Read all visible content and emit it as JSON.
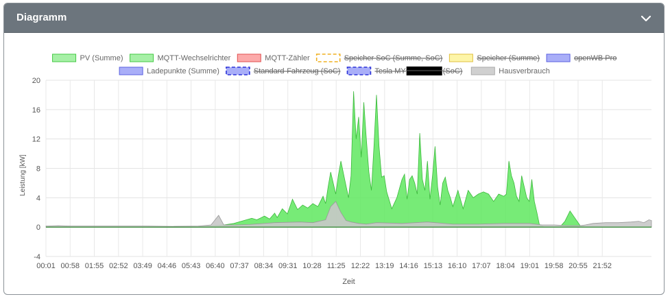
{
  "panel": {
    "title": "Diagramm",
    "collapse_icon": "chevron-down-icon"
  },
  "chart_data": {
    "type": "area",
    "xlabel": "Zeit",
    "ylabel": "Leistung [kW]",
    "ylim": [
      -4,
      20
    ],
    "yticks": [
      -4,
      0,
      4,
      8,
      12,
      16,
      20
    ],
    "xlim": [
      0.0167,
      23.8
    ],
    "xticks": [
      "00:01",
      "00:58",
      "01:55",
      "02:52",
      "03:49",
      "04:46",
      "05:43",
      "06:40",
      "07:37",
      "08:34",
      "09:31",
      "10:28",
      "11:25",
      "12:22",
      "13:19",
      "14:16",
      "15:13",
      "16:10",
      "17:07",
      "18:04",
      "19:01",
      "19:58",
      "20:55",
      "21:52"
    ],
    "grid": true,
    "legend_position": "top",
    "legend": [
      {
        "name": "PV (Summe)",
        "fill": "#a6f0a6",
        "stroke": "#44c944",
        "dashed": false,
        "hidden": false
      },
      {
        "name": "MQTT-Wechselrichter",
        "fill": "#a6f0a6",
        "stroke": "#44c944",
        "dashed": false,
        "hidden": false
      },
      {
        "name": "MQTT-Zähler",
        "fill": "#fcaaaa",
        "stroke": "#e05050",
        "dashed": false,
        "hidden": false
      },
      {
        "name": "Speicher SoC (Summe, SoC)",
        "fill": "#ffffff",
        "stroke": "#f0b020",
        "dashed": true,
        "hidden": true
      },
      {
        "name": "Speicher (Summe)",
        "fill": "#fdf5a8",
        "stroke": "#e0c040",
        "dashed": false,
        "hidden": true
      },
      {
        "name": "openWB Pro",
        "fill": "#a9aef8",
        "stroke": "#5a60e0",
        "dashed": false,
        "hidden": true
      },
      {
        "name": "Ladepunkte (Summe)",
        "fill": "#a9aef8",
        "stroke": "#5a60e0",
        "dashed": false,
        "hidden": false
      },
      {
        "name": "Standard-Fahrzeug (SoC)",
        "fill": "#a9aef8",
        "stroke": "#2b32d8",
        "dashed": true,
        "hidden": true
      },
      {
        "name": "Tesla MY",
        "suffix": "(SoC)",
        "fill": "#a9aef8",
        "stroke": "#2b32d8",
        "dashed": true,
        "hidden": true,
        "redacted": true
      },
      {
        "name": "Hausverbrauch",
        "fill": "#d0d0d0",
        "stroke": "#aaaaaa",
        "dashed": false,
        "hidden": false
      }
    ],
    "series": [
      {
        "name": "PV (Summe)",
        "color": "#5fe85f",
        "stroke": "#3bb83b",
        "x": [
          0.02,
          6.0,
          6.6,
          7.0,
          7.4,
          7.8,
          8.1,
          8.3,
          8.6,
          8.8,
          9.0,
          9.1,
          9.3,
          9.5,
          9.7,
          9.9,
          10.1,
          10.3,
          10.5,
          10.7,
          10.9,
          11.0,
          11.1,
          11.2,
          11.3,
          11.4,
          11.5,
          11.6,
          11.75,
          11.9,
          12.0,
          12.1,
          12.2,
          12.3,
          12.4,
          12.5,
          12.6,
          12.7,
          12.8,
          12.9,
          13.0,
          13.1,
          13.2,
          13.3,
          13.4,
          13.6,
          13.8,
          14.0,
          14.1,
          14.2,
          14.3,
          14.4,
          14.5,
          14.6,
          14.7,
          14.8,
          14.9,
          15.0,
          15.1,
          15.2,
          15.3,
          15.4,
          15.5,
          15.6,
          15.7,
          15.8,
          15.9,
          16.0,
          16.2,
          16.4,
          16.6,
          16.8,
          17.0,
          17.2,
          17.4,
          17.6,
          17.8,
          18.0,
          18.1,
          18.2,
          18.3,
          18.4,
          18.5,
          18.6,
          18.7,
          18.8,
          18.9,
          19.0,
          19.1,
          19.2,
          19.3,
          19.4,
          19.6,
          19.8,
          20.0,
          20.2,
          20.4,
          20.6,
          20.8,
          21.0,
          21.2,
          21.4,
          23.8
        ],
        "y": [
          0,
          0,
          0.2,
          0.3,
          0.5,
          0.9,
          1.2,
          1.0,
          1.5,
          1.1,
          1.9,
          1.3,
          2.5,
          1.8,
          3.8,
          2.4,
          3.0,
          2.6,
          3.2,
          2.8,
          4.2,
          3.2,
          5.5,
          7.5,
          6.0,
          4.5,
          7.0,
          9.0,
          6.5,
          4.0,
          7.0,
          18.5,
          12.0,
          15.0,
          9.5,
          17.0,
          12.0,
          7.5,
          5.0,
          11.0,
          18.0,
          11.0,
          6.8,
          7.0,
          4.8,
          2.5,
          4.0,
          6.5,
          7.2,
          3.8,
          6.5,
          7.0,
          6.0,
          4.5,
          12.8,
          6.5,
          5.0,
          9.0,
          3.8,
          7.0,
          11.0,
          5.5,
          3.0,
          6.0,
          6.8,
          5.0,
          4.0,
          2.8,
          5.0,
          2.5,
          5.0,
          4.0,
          4.5,
          4.8,
          4.5,
          3.5,
          4.5,
          4.2,
          4.5,
          9.0,
          7.0,
          6.0,
          4.2,
          3.5,
          7.0,
          5.5,
          4.0,
          3.5,
          6.5,
          3.5,
          2.0,
          0.3,
          0,
          0,
          0,
          0,
          0.8,
          2.2,
          1.2,
          0.2,
          0,
          0,
          0
        ]
      },
      {
        "name": "Hausverbrauch",
        "color": "#c8c8c8",
        "stroke": "#999999",
        "x": [
          0.02,
          0.5,
          1.0,
          2.0,
          3.0,
          4.0,
          5.0,
          6.0,
          6.5,
          6.8,
          7.0,
          7.5,
          8.0,
          9.0,
          10.0,
          10.5,
          11.0,
          11.2,
          11.4,
          11.6,
          11.8,
          12.0,
          12.3,
          12.6,
          13.0,
          14.0,
          15.0,
          16.0,
          17.0,
          18.0,
          19.0,
          19.5,
          20.0,
          20.5,
          21.0,
          21.2,
          21.5,
          22.0,
          22.5,
          23.0,
          23.3,
          23.5,
          23.7,
          23.8
        ],
        "y": [
          0.15,
          0.2,
          0.15,
          0.15,
          0.15,
          0.15,
          0.1,
          0.15,
          0.3,
          1.6,
          0.3,
          0.3,
          0.35,
          0.6,
          0.7,
          0.6,
          1.0,
          2.8,
          3.5,
          2.0,
          0.9,
          0.7,
          0.5,
          0.4,
          0.6,
          0.5,
          0.7,
          0.4,
          0.4,
          0.5,
          0.5,
          0.3,
          0.3,
          0.2,
          0.2,
          0.3,
          0.5,
          0.6,
          0.6,
          0.7,
          0.8,
          0.6,
          1.0,
          0.9
        ]
      }
    ]
  }
}
